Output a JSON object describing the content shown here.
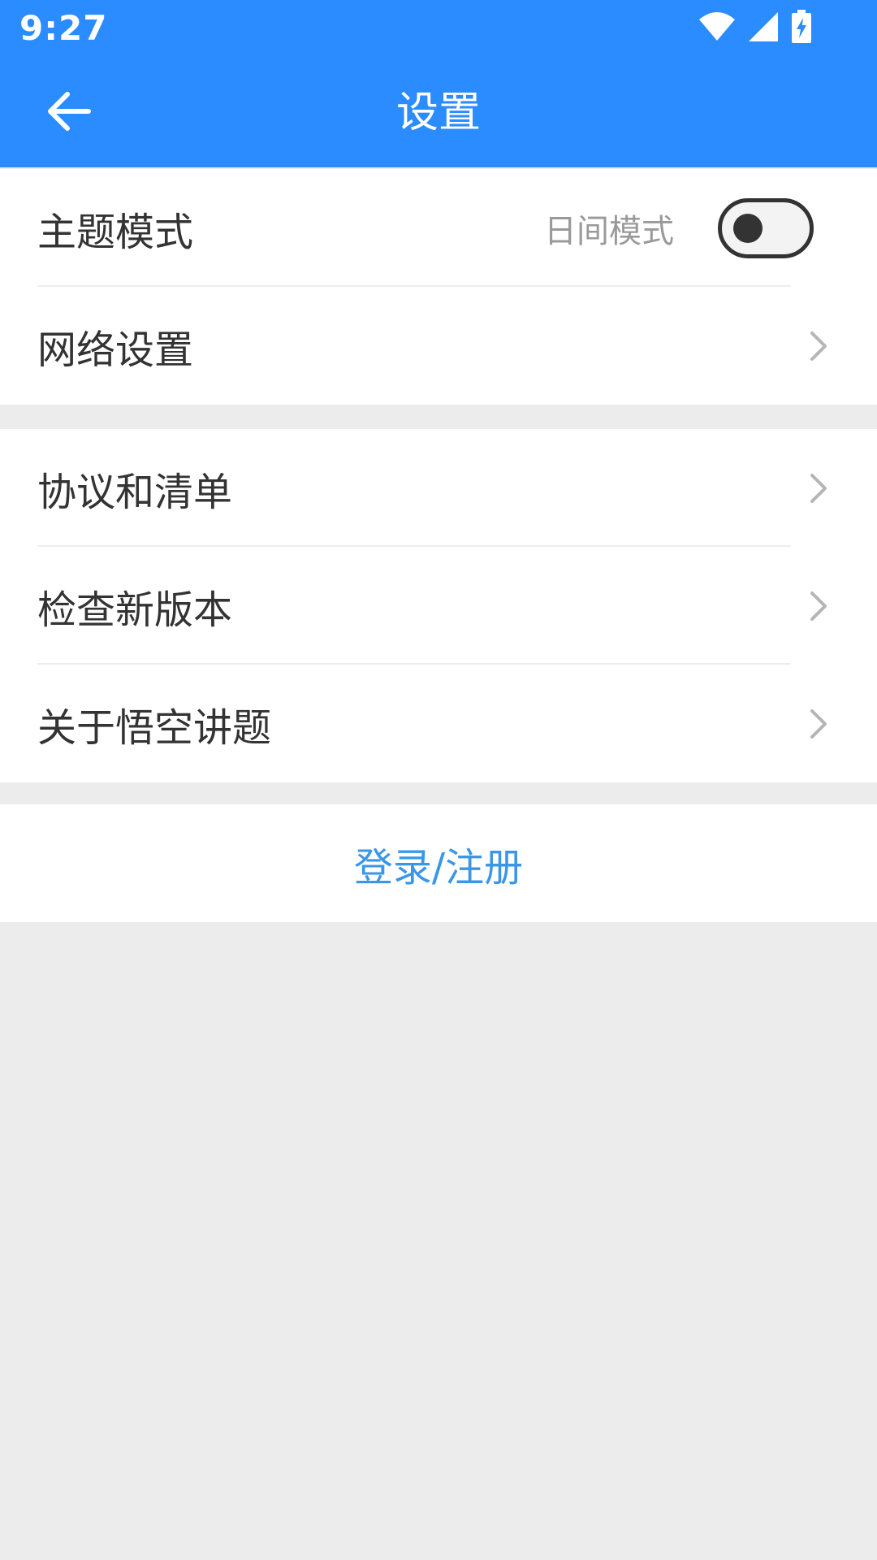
{
  "status_bar": {
    "time": "9:27",
    "icons": [
      "wifi-icon",
      "signal-icon",
      "battery-charging-icon"
    ]
  },
  "app_bar": {
    "title": "设置",
    "back_icon": "arrow-left-icon"
  },
  "colors": {
    "accent": "#2a8cff",
    "link": "#3a96e6",
    "background": "#ececec"
  },
  "group1": {
    "theme": {
      "label": "主题模式",
      "value": "日间模式",
      "toggle_on": false
    },
    "network": {
      "label": "网络设置"
    }
  },
  "group2": {
    "items": [
      {
        "label": "协议和清单"
      },
      {
        "label": "检查新版本"
      },
      {
        "label": "关于悟空讲题"
      }
    ]
  },
  "login": {
    "label": "登录/注册"
  }
}
